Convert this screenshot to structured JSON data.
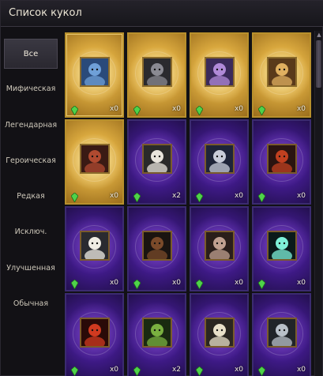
{
  "window": {
    "title": "Список кукол"
  },
  "sidebar": {
    "items": [
      {
        "label": "Все"
      },
      {
        "label": "Мифическая"
      },
      {
        "label": "Легендарная"
      },
      {
        "label": "Героическая"
      },
      {
        "label": "Редкая"
      },
      {
        "label": "Исключ."
      },
      {
        "label": "Улучшенная"
      },
      {
        "label": "Обычная"
      }
    ]
  },
  "dolls": [
    {
      "count": "x0",
      "frame": "gold",
      "portrait": "blue-armored-knight"
    },
    {
      "count": "x0",
      "frame": "gold",
      "portrait": "dark-armored-knight"
    },
    {
      "count": "x0",
      "frame": "gold",
      "portrait": "purple-helmed-warrior"
    },
    {
      "count": "x0",
      "frame": "gold",
      "portrait": "horned-gold-warrior"
    },
    {
      "count": "x0",
      "frame": "gold",
      "portrait": "red-hooded-warrior"
    },
    {
      "count": "x2",
      "frame": "purple",
      "portrait": "white-haired-girl"
    },
    {
      "count": "x0",
      "frame": "purple",
      "portrait": "silver-haired-elf"
    },
    {
      "count": "x0",
      "frame": "purple",
      "portrait": "red-dwarf"
    },
    {
      "count": "x0",
      "frame": "purple",
      "portrait": "white-haired-elf"
    },
    {
      "count": "x0",
      "frame": "purple",
      "portrait": "dark-beast"
    },
    {
      "count": "x0",
      "frame": "purple",
      "portrait": "antlered-spirit"
    },
    {
      "count": "x0",
      "frame": "purple",
      "portrait": "glowing-orb"
    },
    {
      "count": "x0",
      "frame": "purple",
      "portrait": "red-demon"
    },
    {
      "count": "x2",
      "frame": "purple",
      "portrait": "green-goblin"
    },
    {
      "count": "x0",
      "frame": "purple",
      "portrait": "white-bearded-elder"
    },
    {
      "count": "x0",
      "frame": "purple",
      "portrait": "silver-armored-knight"
    }
  ],
  "colors": {
    "gold": "#d9a83e",
    "purple": "#3f1a88",
    "gem": "#4fd24a"
  }
}
